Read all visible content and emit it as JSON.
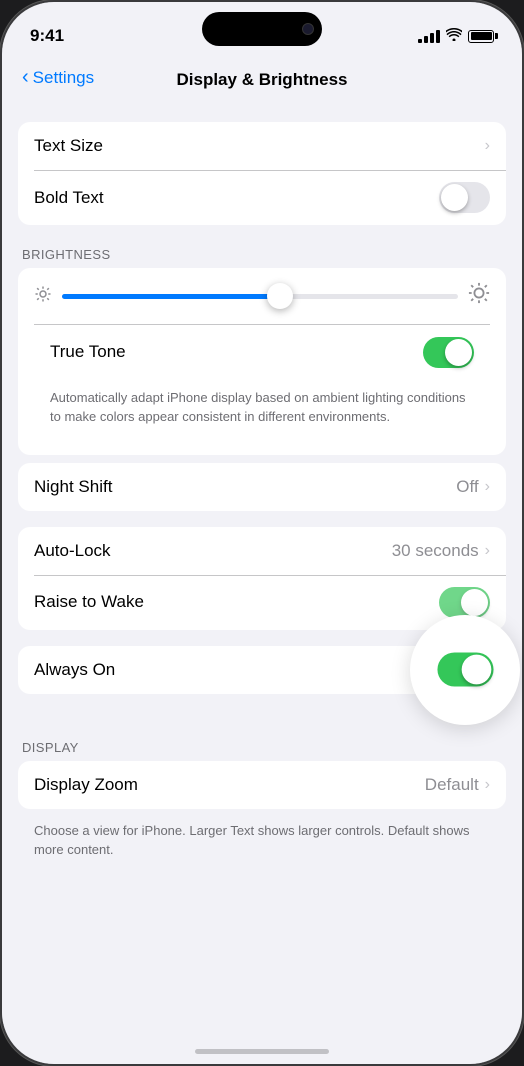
{
  "statusBar": {
    "time": "9:41"
  },
  "navBar": {
    "backLabel": "Settings",
    "title": "Display & Brightness"
  },
  "sections": {
    "textSize": {
      "label": "Text Size"
    },
    "boldText": {
      "label": "Bold Text",
      "toggleState": "off"
    },
    "brightnessLabel": "BRIGHTNESS",
    "brightness": {
      "sliderPercent": 55
    },
    "trueTone": {
      "label": "True Tone",
      "toggleState": "on",
      "description": "Automatically adapt iPhone display based on ambient lighting conditions to make colors appear consistent in different environments."
    },
    "nightShift": {
      "label": "Night Shift",
      "value": "Off"
    },
    "autoLock": {
      "label": "Auto-Lock",
      "value": "30 seconds"
    },
    "raiseToWake": {
      "label": "Raise to Wake",
      "toggleState": "on"
    },
    "displayLabel": "DISPLAY",
    "alwaysOn": {
      "label": "Always On",
      "toggleState": "on"
    },
    "displayZoom": {
      "label": "Display Zoom",
      "value": "Default",
      "description": "Choose a view for iPhone. Larger Text shows larger controls. Default shows more content."
    }
  }
}
